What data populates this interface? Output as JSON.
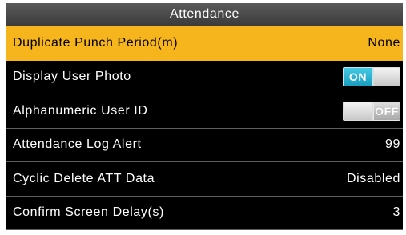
{
  "window": {
    "title": "Attendance"
  },
  "settings": [
    {
      "label": "Duplicate Punch Period(m)",
      "value": "None"
    },
    {
      "label": "Display User Photo",
      "toggle": "ON"
    },
    {
      "label": "Alphanumeric User ID",
      "toggle": "OFF"
    },
    {
      "label": "Attendance Log Alert",
      "value": "99"
    },
    {
      "label": "Cyclic Delete ATT Data",
      "value": "Disabled"
    },
    {
      "label": "Confirm Screen Delay(s)",
      "value": "3"
    }
  ],
  "colors": {
    "selected_row": "#f6b51d",
    "toggle_on": "#1a9ec0",
    "background": "#000000"
  }
}
